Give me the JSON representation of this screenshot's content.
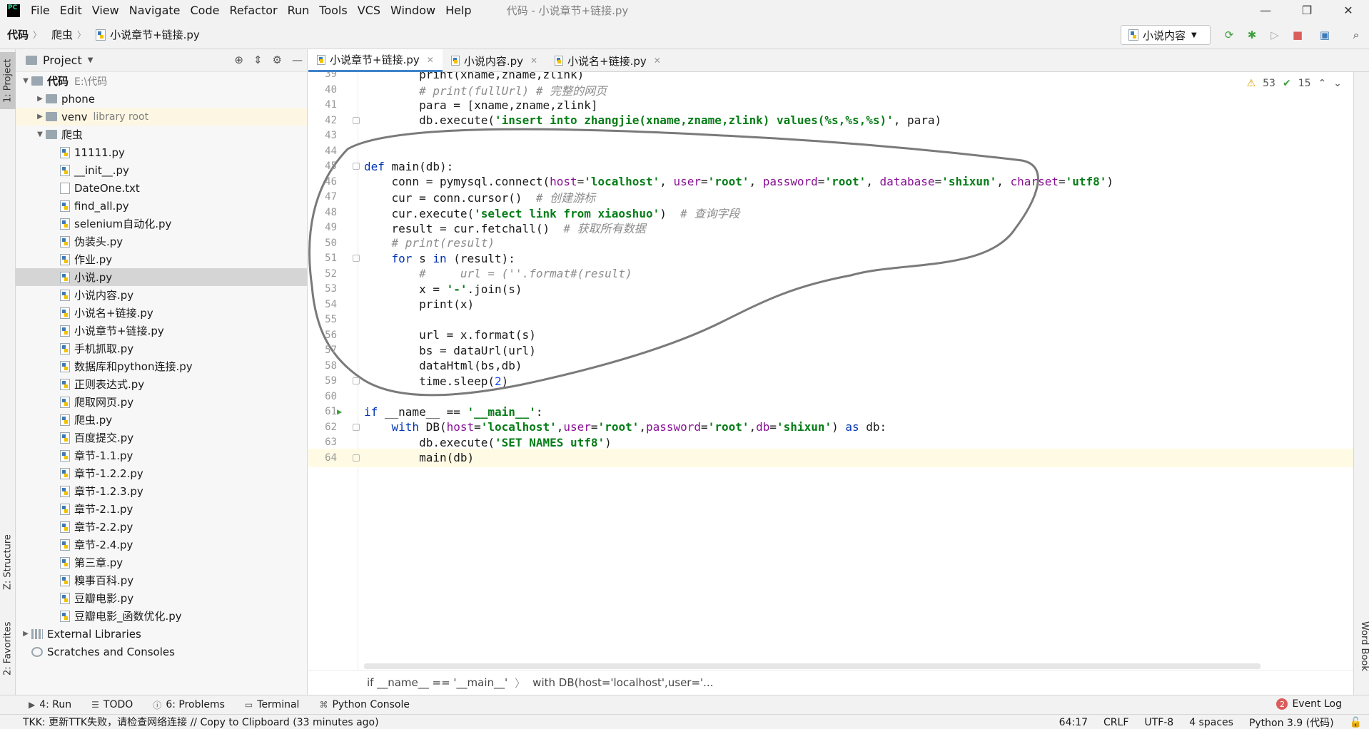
{
  "app": {
    "logo_text": "PC",
    "menu": [
      "File",
      "Edit",
      "View",
      "Navigate",
      "Code",
      "Refactor",
      "Run",
      "Tools",
      "VCS",
      "Window",
      "Help"
    ],
    "title": "代码 - 小说章节+链接.py"
  },
  "nav": {
    "breadcrumbs": [
      "代码",
      "爬虫",
      "小说章节+链接.py"
    ],
    "run_config": "小说内容"
  },
  "left_strip": {
    "project_tab": "1: Project",
    "structure_tab": "Z: Structure",
    "favorites_tab": "2: Favorites"
  },
  "project": {
    "header": "Project",
    "root": {
      "name": "代码",
      "path": "E:\\代码"
    },
    "items": [
      {
        "name": "phone",
        "kind": "folder"
      },
      {
        "name": "venv",
        "kind": "folder",
        "note": "library root"
      },
      {
        "name": "爬虫",
        "kind": "folder-open"
      },
      {
        "name": "11111.py"
      },
      {
        "name": "__init__.py"
      },
      {
        "name": "DateOne.txt"
      },
      {
        "name": "find_all.py"
      },
      {
        "name": "selenium自动化.py"
      },
      {
        "name": "伪装头.py"
      },
      {
        "name": "作业.py"
      },
      {
        "name": "小说.py"
      },
      {
        "name": "小说内容.py"
      },
      {
        "name": "小说名+链接.py"
      },
      {
        "name": "小说章节+链接.py"
      },
      {
        "name": "手机抓取.py"
      },
      {
        "name": "数据库和python连接.py"
      },
      {
        "name": "正则表达式.py"
      },
      {
        "name": "爬取网页.py"
      },
      {
        "name": "爬虫.py"
      },
      {
        "name": "百度提交.py"
      },
      {
        "name": "章节-1.1.py"
      },
      {
        "name": "章节-1.2.2.py"
      },
      {
        "name": "章节-1.2.3.py"
      },
      {
        "name": "章节-2.1.py"
      },
      {
        "name": "章节-2.2.py"
      },
      {
        "name": "章节-2.4.py"
      },
      {
        "name": "第三章.py"
      },
      {
        "name": "糗事百科.py"
      },
      {
        "name": "豆瓣电影.py"
      },
      {
        "name": "豆瓣电影_函数优化.py"
      }
    ],
    "external_libraries": "External Libraries",
    "scratches": "Scratches and Consoles"
  },
  "tabs": [
    {
      "label": "小说章节+链接.py",
      "active": true
    },
    {
      "label": "小说内容.py",
      "active": false
    },
    {
      "label": "小说名+链接.py",
      "active": false
    }
  ],
  "inspections": {
    "warnings": "53",
    "weak_warnings": "15"
  },
  "code_lines": [
    {
      "n": "39",
      "html": "        <span>print</span>(xname,zname,zlink)"
    },
    {
      "n": "40",
      "html": "        <span class='cm'># print(fullUrl) # 完整的网页</span>"
    },
    {
      "n": "41",
      "html": "        para = [xname,zname,zlink]"
    },
    {
      "n": "42",
      "html": "        db.execute(<span class='str'>'insert into zhangjie(xname,zname,zlink) values(%s,%s,%s)'</span>, para)"
    },
    {
      "n": "43",
      "html": ""
    },
    {
      "n": "44",
      "html": ""
    },
    {
      "n": "45",
      "html": "<span class='kw'>def</span> main(db):"
    },
    {
      "n": "46",
      "html": "    conn = pymysql.connect(<span class='pm'>host</span>=<span class='str'>'localhost'</span>, <span class='pm'>user</span>=<span class='str'>'root'</span>, <span class='pm'>password</span>=<span class='str'>'root'</span>, <span class='pm'>database</span>=<span class='str'>'shixun'</span>, <span class='pm'>charset</span>=<span class='str'>'utf8'</span>)"
    },
    {
      "n": "47",
      "html": "    cur = conn.cursor()  <span class='cm'># 创建游标</span>"
    },
    {
      "n": "48",
      "html": "    cur.execute(<span class='str'>'select link from xiaoshuo'</span>)  <span class='cm'># 查询字段</span>"
    },
    {
      "n": "49",
      "html": "    result = cur.fetchall()  <span class='cm'># 获取所有数据</span>"
    },
    {
      "n": "50",
      "html": "    <span class='cm'># print(result)</span>"
    },
    {
      "n": "51",
      "html": "    <span class='kw'>for</span> s <span class='kw'>in</span> (result):"
    },
    {
      "n": "52",
      "html": "        <span class='cm'>#     url = (''.format#(result)</span>"
    },
    {
      "n": "53",
      "html": "        x = <span class='str'>'-'</span>.join(s)"
    },
    {
      "n": "54",
      "html": "        <span>print</span>(x)"
    },
    {
      "n": "55",
      "html": ""
    },
    {
      "n": "56",
      "html": "        url = x.format(s)"
    },
    {
      "n": "57",
      "html": "        bs = dataUrl(url)"
    },
    {
      "n": "58",
      "html": "        dataHtml(bs,db)"
    },
    {
      "n": "59",
      "html": "        time.sleep(<span class='num'>2</span>)"
    },
    {
      "n": "60",
      "html": ""
    },
    {
      "n": "61",
      "html": "<span class='kw'>if</span> __name__ == <span class='str'>'__main__'</span>:"
    },
    {
      "n": "62",
      "html": "    <span class='kw'>with</span> DB(<span class='pm'>host</span>=<span class='str'>'localhost'</span>,<span class='pm'>user</span>=<span class='str'>'root'</span>,<span class='pm'>password</span>=<span class='str'>'root'</span>,<span class='pm'>db</span>=<span class='str'>'shixun'</span>) <span class='kw'>as</span> db:"
    },
    {
      "n": "63",
      "html": "        db.execute(<span class='str'>'SET NAMES utf8'</span>)"
    },
    {
      "n": "64",
      "html": "        main(db)"
    }
  ],
  "code_crumbs": [
    "if __name__ == '__main__'",
    "with DB(host='localhost',user='..."
  ],
  "right_strip": {
    "word_book": "Word Book"
  },
  "bottom_tools": [
    {
      "label": "4: Run",
      "icon": "run-icon"
    },
    {
      "label": "TODO",
      "icon": "todo-icon"
    },
    {
      "label": "6: Problems",
      "icon": "problems-icon"
    },
    {
      "label": "Terminal",
      "icon": "terminal-icon"
    },
    {
      "label": "Python Console",
      "icon": "python-console-icon"
    }
  ],
  "event_log": {
    "count": "2",
    "label": "Event Log"
  },
  "status": {
    "message": "TKK: 更新TTK失败，请检查网络连接 // Copy to Clipboard (33 minutes ago)",
    "position": "64:17",
    "line_sep": "CRLF",
    "encoding": "UTF-8",
    "indent": "4 spaces",
    "interpreter": "Python 3.9 (代码)"
  }
}
